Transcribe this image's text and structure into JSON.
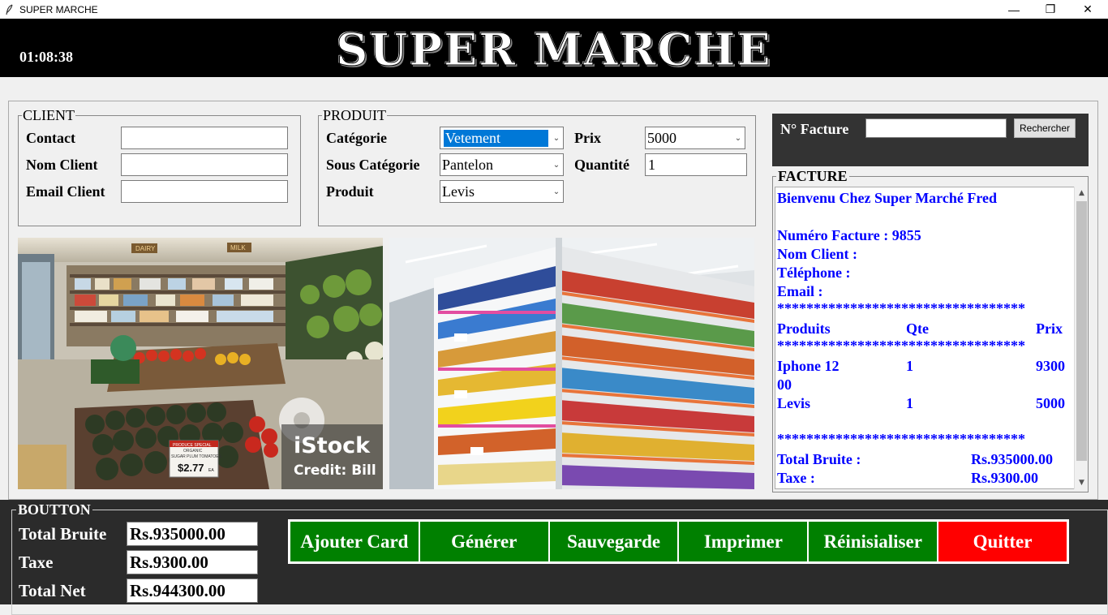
{
  "window": {
    "title": "SUPER MARCHE",
    "minimize": "—",
    "restore": "❐",
    "close": "✕"
  },
  "header": {
    "clock": "01:08:38",
    "title": "SUPER MARCHE"
  },
  "client": {
    "legend": "CLIENT",
    "contact_label": "Contact",
    "contact_value": "",
    "name_label": "Nom Client",
    "name_value": "",
    "email_label": "Email Client",
    "email_value": ""
  },
  "produit": {
    "legend": "PRODUIT",
    "category_label": "Catégorie",
    "category_value": "Vetement",
    "subcategory_label": "Sous Catégorie",
    "subcategory_value": "Pantelon",
    "product_label": "Produit",
    "product_value": "Levis",
    "price_label": "Prix",
    "price_value": "5000",
    "qty_label": "Quantité",
    "qty_value": "1"
  },
  "images": {
    "left_watermark": "iStock",
    "left_credit": "Credit: Bill",
    "left_dairy": "DAIRY",
    "left_milk": "MILK",
    "left_sign_line1": "PRODUCE SPECIAL",
    "left_sign_line2": "ORGANIC",
    "left_sign_line3": "SUGAR PLUM TOMATOES",
    "left_sign_price": "$2.77",
    "left_sign_unit": "EA"
  },
  "search": {
    "label": "N° Facture",
    "value": "",
    "button": "Rechercher"
  },
  "bill": {
    "legend": "FACTURE",
    "welcome": "Bienvenu Chez Super Marché Fred",
    "invoice_number": "Numéro Facture : 9855",
    "client_name": "Nom Client :",
    "phone": "Téléphone :",
    "email": "Email :",
    "separator": "**********************************",
    "col_products": "Produits",
    "col_qty": "Qte",
    "col_price": "Prix",
    "items": [
      {
        "name": "Iphone 12",
        "name_cont": "00",
        "qty": "1",
        "price": "9300"
      },
      {
        "name": "Levis",
        "name_cont": "",
        "qty": "1",
        "price": "5000"
      }
    ],
    "total_label": "Total Bruite :",
    "total_value": "Rs.935000.00",
    "tax_label": "Taxe :",
    "tax_value": "Rs.9300.00"
  },
  "bottom": {
    "legend": "BOUTTON",
    "gross_label": "Total Bruite",
    "gross_value": "Rs.935000.00",
    "tax_label": "Taxe",
    "tax_value": "Rs.9300.00",
    "net_label": "Total Net",
    "net_value": "Rs.944300.00"
  },
  "buttons": {
    "add": "Ajouter Card",
    "generate": "Générer",
    "save": "Sauvegarde",
    "print": "Imprimer",
    "reset": "Réinisialiser",
    "quit": "Quitter"
  },
  "colors": {
    "accent_green": "#008000",
    "quit_red": "#ff0000",
    "bill_text": "#0000ff",
    "header_bg": "#000000",
    "bottom_bg": "#2b2b2b"
  }
}
